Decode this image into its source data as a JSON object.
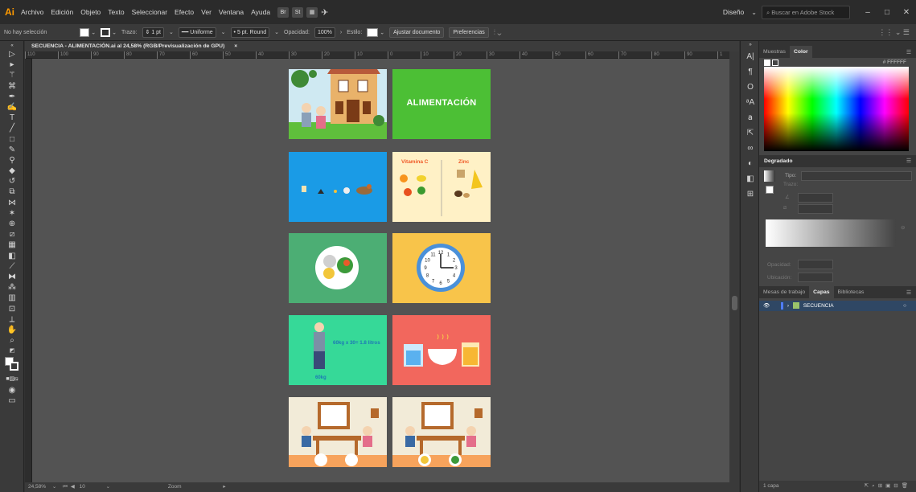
{
  "menubar": {
    "logo": "Ai",
    "items": [
      "Archivo",
      "Edición",
      "Objeto",
      "Texto",
      "Seleccionar",
      "Efecto",
      "Ver",
      "Ventana",
      "Ayuda"
    ],
    "right": {
      "workspace": "Diseño",
      "stock_search_placeholder": "Buscar en Adobe Stock"
    }
  },
  "controlbar": {
    "selection": "No hay selección",
    "stroke_label": "Trazo:",
    "stroke_value": "1 pt",
    "profile": "Uniforme",
    "brush": "5 pt. Round",
    "opacity_label": "Opacidad:",
    "opacity_value": "100%",
    "style_label": "Estilo:",
    "btn_adjust": "Ajustar documento",
    "btn_prefs": "Preferencias"
  },
  "document": {
    "tab": "SECUENCIA - ALIMENTACIÓN.ai al 24,58% (RGB/Previsualización de GPU)",
    "close": "×"
  },
  "ruler": {
    "ticks": [
      "110",
      "100",
      "90",
      "80",
      "70",
      "60",
      "50",
      "40",
      "30",
      "20",
      "10",
      "0",
      "10",
      "20",
      "30",
      "40",
      "50",
      "60",
      "70",
      "80",
      "90",
      "1"
    ]
  },
  "cards": {
    "title_card": "ALIMENTACIÓN",
    "vitamin_c": "Vitamina C",
    "zinc": "Zinc",
    "water_formula": "60kg x 30= 1.8 litros",
    "weight": "60kg",
    "clock_numbers": [
      "12",
      "1",
      "2",
      "3",
      "4",
      "5",
      "6",
      "7",
      "8",
      "9",
      "10",
      "11"
    ]
  },
  "statusbar": {
    "zoom": "24,58%",
    "artboard": "10",
    "mode": "Zoom"
  },
  "panels": {
    "color_tabs": [
      "Muestras",
      "Color"
    ],
    "hex": "FFFFFF",
    "gradient_tab": "Degradado",
    "gradient_type": "Tipo:",
    "gradient_stroke": "Trazo:",
    "gradient_opacity": "Opacidad:",
    "gradient_location": "Ubicación:",
    "layer_tabs": [
      "Mesas de trabajo",
      "Capas",
      "Bibliotecas"
    ],
    "layer_name": "SECUENCIA",
    "layer_count": "1 capa"
  },
  "colors": {
    "accent": "#ff9a00",
    "panel": "#454545",
    "selection": "#2f4764"
  }
}
